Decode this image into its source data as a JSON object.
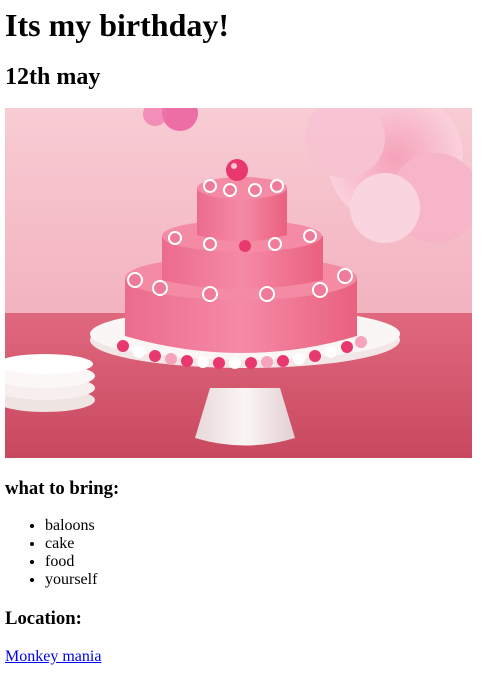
{
  "page": {
    "title": "Its my birthday!",
    "date": "12th may"
  },
  "image": {
    "subject": "pink three-tier birthday cake on white cake stand",
    "colors": {
      "wall": "#f6c2cc",
      "table": "#d8566e",
      "frosting": "#f27596",
      "stand": "#f5ecec",
      "flower": "#f7a9c0"
    }
  },
  "bring": {
    "heading": "what to bring:",
    "items": [
      "baloons",
      "cake",
      "food",
      "yourself"
    ]
  },
  "location": {
    "heading": "Location:",
    "link_text": "Monkey mania"
  }
}
